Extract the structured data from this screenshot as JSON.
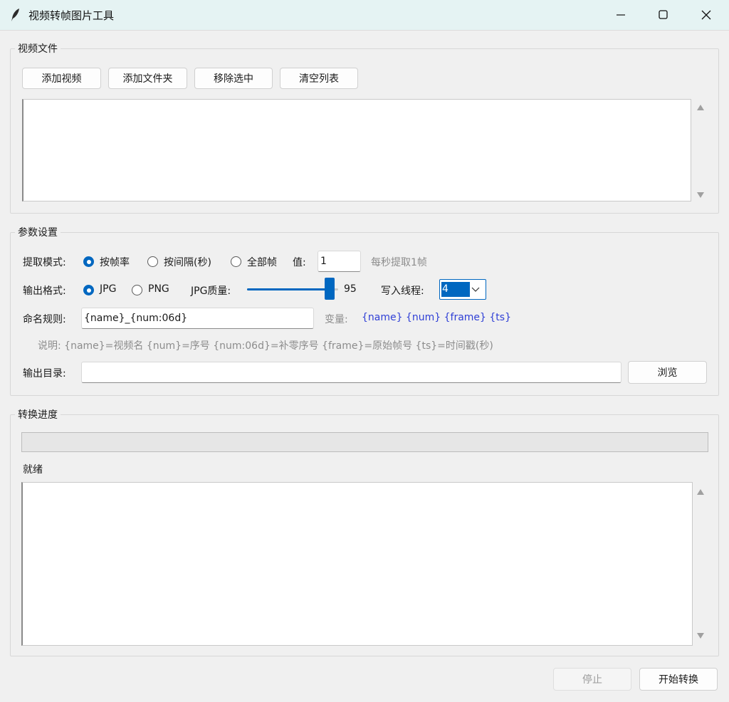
{
  "window": {
    "title": "视频转帧图片工具"
  },
  "video_section": {
    "legend": "视频文件",
    "buttons": {
      "add_video": "添加视频",
      "add_folder": "添加文件夹",
      "remove_selected": "移除选中",
      "clear_list": "清空列表"
    },
    "files": []
  },
  "params_section": {
    "legend": "参数设置",
    "extract_mode": {
      "label": "提取模式:",
      "options": [
        "按帧率",
        "按间隔(秒)",
        "全部帧"
      ],
      "selected": "按帧率",
      "value_label": "值:",
      "value": "1",
      "hint": "每秒提取1帧"
    },
    "output_format": {
      "label": "输出格式:",
      "options": [
        "JPG",
        "PNG"
      ],
      "selected": "JPG",
      "quality_label": "JPG质量:",
      "quality_value": "95",
      "quality_percent": 95,
      "threads_label": "写入线程:",
      "threads_value": "4"
    },
    "naming": {
      "label": "命名规则:",
      "value": "{name}_{num:06d}",
      "vars_label": "变量:",
      "vars": "{name} {num} {frame} {ts}",
      "description": "说明: {name}=视频名  {num}=序号  {num:06d}=补零序号  {frame}=原始帧号  {ts}=时间戳(秒)"
    },
    "output_dir": {
      "label": "输出目录:",
      "value": "",
      "browse": "浏览"
    }
  },
  "progress_section": {
    "legend": "转换进度",
    "progress": 0,
    "status": "就绪",
    "log": ""
  },
  "footer": {
    "stop": "停止",
    "start": "开始转换"
  }
}
